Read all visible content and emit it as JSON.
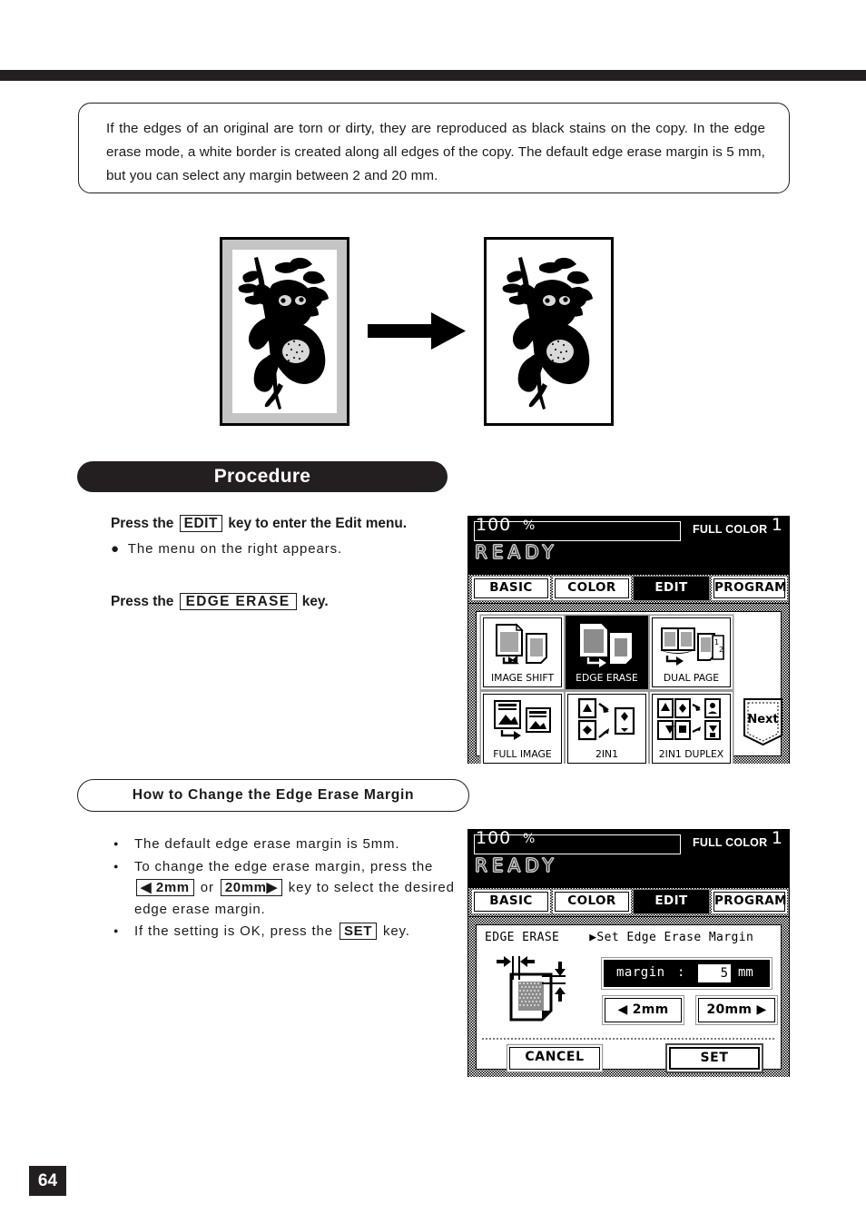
{
  "page": {
    "number": "64"
  },
  "intro": {
    "text": "If the edges of an original are torn or dirty, they are reproduced as black stains on the copy. In the edge erase mode, a white border is created along all edges of the copy. The default edge erase margin is 5 mm, but you can select any margin between 2 and 20 mm."
  },
  "illustration": {
    "original_caption": "",
    "copy_caption": ""
  },
  "procedure": {
    "banner": "Procedure",
    "step1": {
      "head_before": "Press the",
      "head_key": "EDIT",
      "head_after": "key to enter the Edit menu.",
      "bullet": "The menu on the right appears."
    },
    "step2": {
      "head_before": "Press the",
      "head_key": "EDGE ERASE",
      "head_after": "key."
    }
  },
  "howto": {
    "banner": "How to Change the Edge Erase Margin",
    "bullet1": "The default edge erase margin is 5mm.",
    "bullet2_a": "To change the edge erase margin, press the",
    "bullet2_key1": "◀ 2mm",
    "bullet2_or": "or",
    "bullet2_key2": "20mm▶",
    "bullet2_b": "key to select the desired",
    "bullet2_c": "edge erase margin.",
    "bullet3_a": "If the setting is OK, press the",
    "bullet3_key": "SET",
    "bullet3_b": "key."
  },
  "lcd_menu": {
    "ratio": "100",
    "percent": "%",
    "copies": "1",
    "color_mode": "FULL COLOR",
    "status": "READY",
    "tabs": [
      {
        "label": "BASIC",
        "selected": false
      },
      {
        "label": "COLOR",
        "selected": false
      },
      {
        "label": "EDIT",
        "selected": true
      },
      {
        "label": "PROGRAM",
        "selected": false
      }
    ],
    "functions": [
      {
        "label": "IMAGE SHIFT",
        "selected": false
      },
      {
        "label": "EDGE ERASE",
        "selected": true
      },
      {
        "label": "DUAL  PAGE",
        "selected": false
      },
      {
        "label": "FULL IMAGE",
        "selected": false
      },
      {
        "label": "2IN1",
        "selected": false
      },
      {
        "label": "2IN1 DUPLEX",
        "selected": false
      }
    ],
    "next_label": "Next"
  },
  "lcd_margin": {
    "ratio": "100",
    "percent": "%",
    "copies": "1",
    "color_mode": "FULL COLOR",
    "status": "READY",
    "tabs": [
      {
        "label": "BASIC",
        "selected": false
      },
      {
        "label": "COLOR",
        "selected": false
      },
      {
        "label": "EDIT",
        "selected": true
      },
      {
        "label": "PROGRAM",
        "selected": false
      }
    ],
    "mode_title": "EDGE ERASE",
    "mode_prompt": "▶Set Edge Erase Margin",
    "margin_label": "margin",
    "margin_colon": ":",
    "margin_value": "5",
    "margin_unit": "mm",
    "decrease_label": "◀  2mm",
    "increase_label": "20mm  ▶",
    "cancel_label": "CANCEL",
    "set_label": "SET"
  },
  "colors": {
    "ink": "#231f20",
    "lcd_bg": "#000000",
    "lcd_fg": "#ffffff",
    "original_border_gray": "#c4c4c4"
  }
}
